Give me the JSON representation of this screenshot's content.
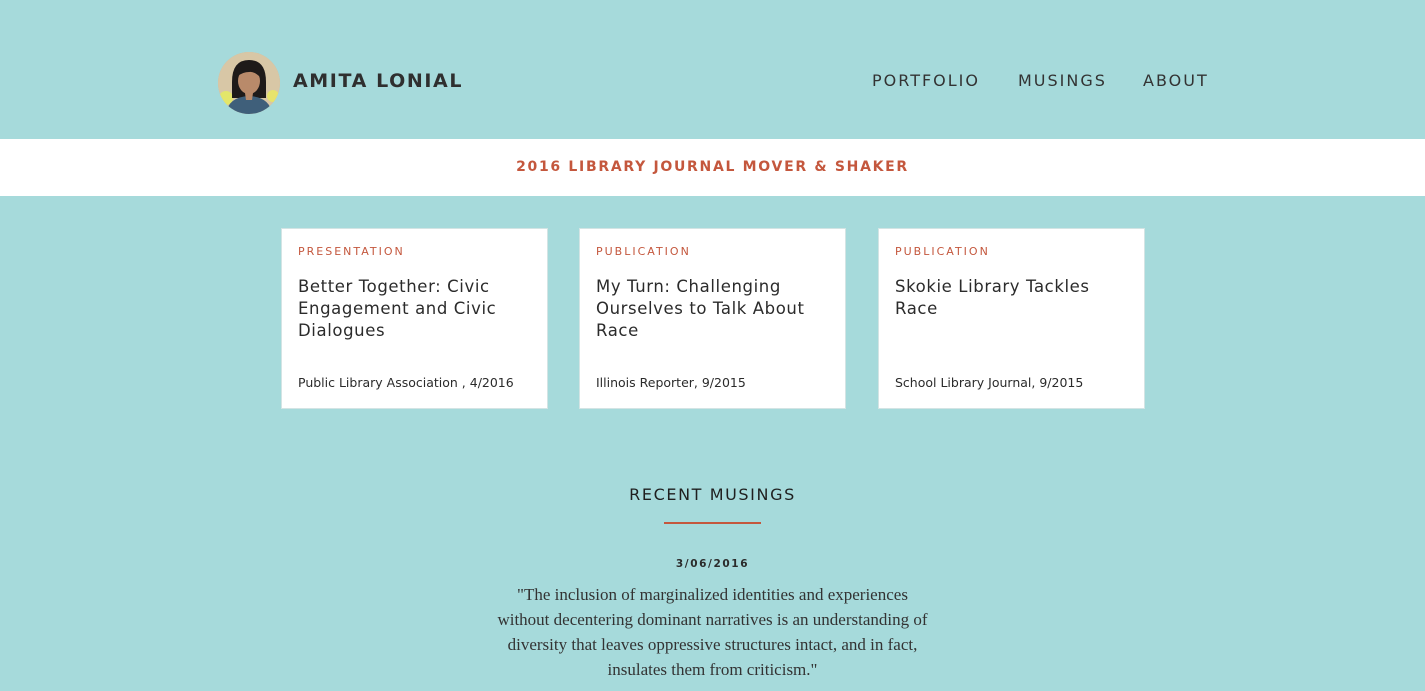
{
  "header": {
    "site_title": "AMITA LONIAL",
    "nav": [
      {
        "label": "PORTFOLIO"
      },
      {
        "label": "MUSINGS"
      },
      {
        "label": "ABOUT"
      }
    ]
  },
  "banner": {
    "text": "2016 LIBRARY JOURNAL MOVER & SHAKER"
  },
  "cards": [
    {
      "type": "PRESENTATION",
      "title": "Better Together: Civic Engagement and Civic Dialogues",
      "source": "Public Library Association , 4/2016"
    },
    {
      "type": "PUBLICATION",
      "title": "My Turn: Challenging Ourselves to Talk About Race",
      "source": "Illinois Reporter, 9/2015"
    },
    {
      "type": "PUBLICATION",
      "title": "Skokie Library Tackles Race",
      "source": "School Library Journal, 9/2015"
    }
  ],
  "musings": {
    "heading": "RECENT MUSINGS",
    "date": "3/06/2016",
    "quote": "\"The inclusion of marginalized identities and experiences without decentering dominant narratives is an understanding of diversity that leaves oppressive structures intact, and in fact, insulates them from criticism.\""
  },
  "colors": {
    "background": "#a6dadb",
    "accent": "#c4573d",
    "card": "#ffffff",
    "text": "#2b2b2b"
  }
}
